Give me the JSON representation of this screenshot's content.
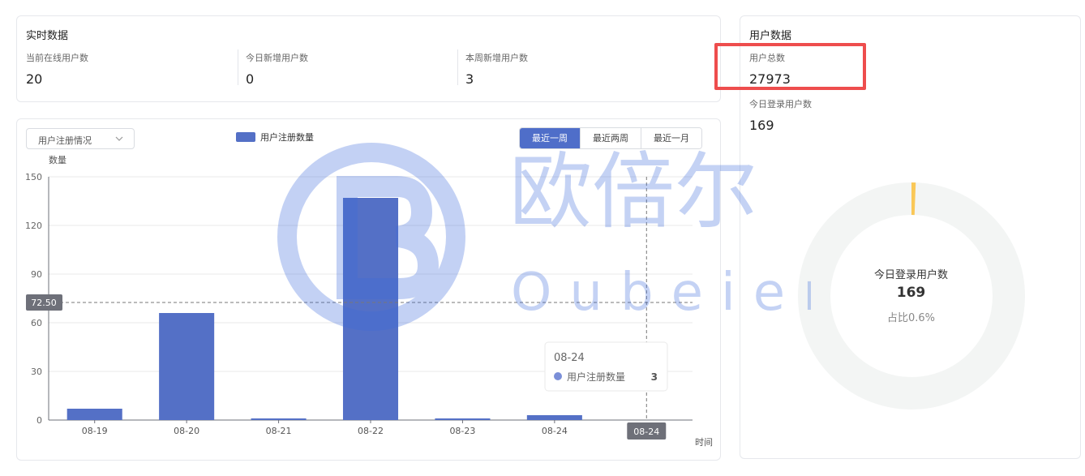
{
  "realtime": {
    "title": "实时数据",
    "stats": [
      {
        "label": "当前在线用户数",
        "value": "20"
      },
      {
        "label": "今日新增用户数",
        "value": "0"
      },
      {
        "label": "本周新增用户数",
        "value": "3"
      }
    ]
  },
  "chart_panel": {
    "select_value": "用户注册情况",
    "legend_label": "用户注册数量",
    "range_buttons": [
      {
        "label": "最近一周",
        "active": true
      },
      {
        "label": "最近两周",
        "active": false
      },
      {
        "label": "最近一月",
        "active": false
      }
    ]
  },
  "chart_data": {
    "type": "bar",
    "categories": [
      "08-19",
      "08-20",
      "08-21",
      "08-22",
      "08-23",
      "08-24"
    ],
    "series": [
      {
        "name": "用户注册数量",
        "values": [
          7,
          66,
          1,
          137,
          1,
          3
        ]
      }
    ],
    "ylabel": "数量",
    "xlabel": "时间",
    "ylim": [
      0,
      150
    ],
    "yticks": [
      0,
      30,
      60,
      90,
      120,
      150
    ],
    "grid": true,
    "legend": "top-center",
    "color": "#5470c6",
    "crosshair": {
      "y_value": "72.50",
      "x_label": "08-24"
    },
    "tooltip": {
      "title": "08-24",
      "series_name": "用户注册数量",
      "value": "3"
    }
  },
  "users": {
    "title": "用户数据",
    "total_label": "用户总数",
    "total_value": "27973",
    "today_login_label": "今日登录用户数",
    "today_login_value": "169"
  },
  "donut": {
    "label": "今日登录用户数",
    "value": "169",
    "ratio_text": "占比0.6%",
    "fraction": 0.006,
    "track_color": "#f3f5f4",
    "accent_color": "#fac858"
  },
  "watermark": {
    "cn_text": "欧倍尔",
    "en_text": "Oubeier",
    "color": "#3d6bdc"
  },
  "colors": {
    "highlight": "#ee4d4d",
    "accent": "#4f6ec9"
  }
}
